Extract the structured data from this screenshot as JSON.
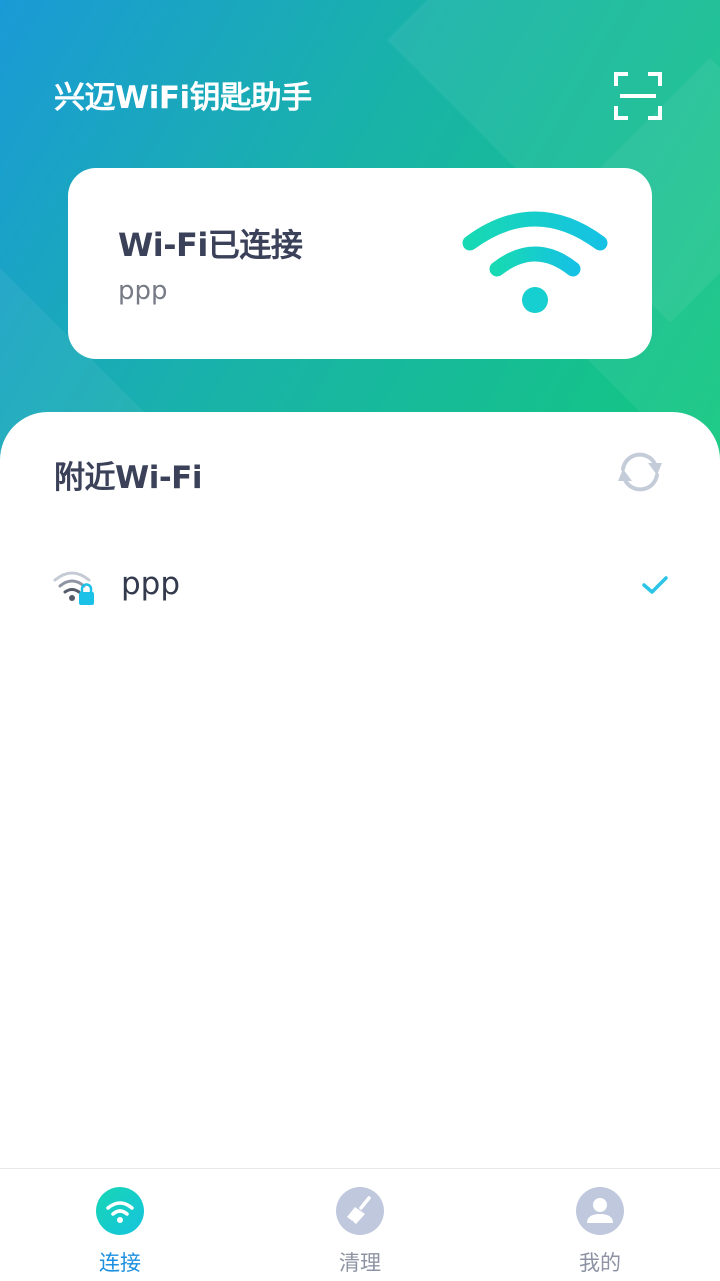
{
  "app": {
    "title": "兴迈WiFi钥匙助手"
  },
  "status_card": {
    "title": "Wi-Fi已连接",
    "ssid": "ppp"
  },
  "nearby": {
    "title": "附近Wi-Fi",
    "networks": [
      {
        "ssid": "ppp",
        "locked": true,
        "connected": true
      }
    ]
  },
  "tabs": [
    {
      "label": "连接",
      "icon": "wifi-icon",
      "active": true
    },
    {
      "label": "清理",
      "icon": "broom-icon",
      "active": false
    },
    {
      "label": "我的",
      "icon": "user-icon",
      "active": false
    }
  ],
  "colors": {
    "brand_green": "#13c87e",
    "brand_blue": "#1a9ad6",
    "accent_teal": "#12d3c5",
    "active_tab": "#1b8fe0",
    "inactive_icon": "#bfc8dc",
    "check": "#2cc5e8"
  }
}
